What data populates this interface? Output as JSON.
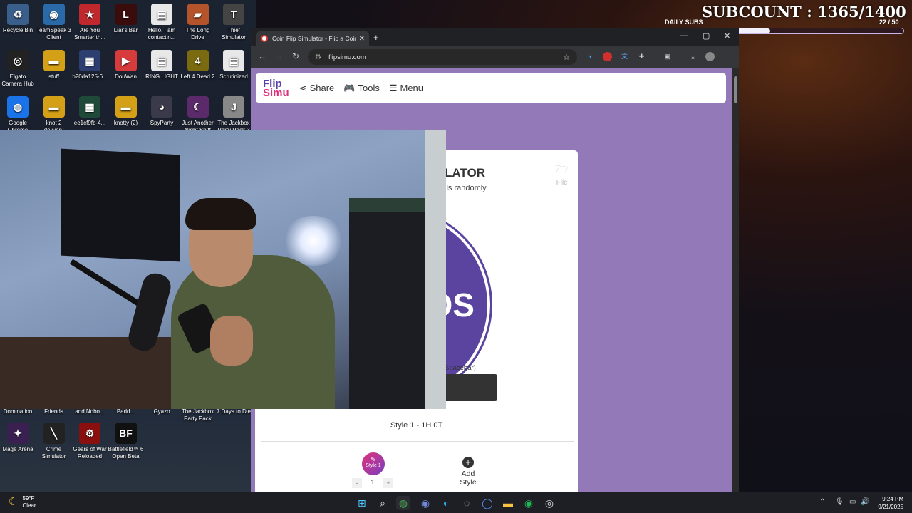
{
  "overlay": {
    "subcount": "SUBCOUNT : 1365/1400",
    "daily_label": "DAILY SUBS",
    "daily_count": "22  / 50",
    "daily_progress": 0.44
  },
  "desktop": {
    "icons": [
      {
        "label": "Recycle Bin",
        "icon": "recycle-bin-icon",
        "glyph": "♻",
        "color": "#3a5f8a"
      },
      {
        "label": "TeamSpeak 3 Client",
        "icon": "teamspeak-icon",
        "glyph": "◉",
        "color": "#2b6aa8"
      },
      {
        "label": "Are You Smarter th...",
        "icon": "game-icon",
        "glyph": "★",
        "color": "#c0282d"
      },
      {
        "label": "Liar's Bar",
        "icon": "liars-bar-icon",
        "glyph": "L",
        "color": "#3a0c0c"
      },
      {
        "label": "Hello, I am contactin...",
        "icon": "document-icon",
        "glyph": "▤",
        "color": "#e8e8e8"
      },
      {
        "label": "The Long Drive",
        "icon": "car-icon",
        "glyph": "▰",
        "color": "#b5532a"
      },
      {
        "label": "Thief Simulator",
        "icon": "thief-icon",
        "glyph": "T",
        "color": "#444"
      },
      {
        "label": "Elgato Camera Hub",
        "icon": "camera-icon",
        "glyph": "◎",
        "color": "#222"
      },
      {
        "label": "stuff",
        "icon": "folder-icon",
        "glyph": "▬",
        "color": "#d4a017"
      },
      {
        "label": "b20da125-6...",
        "icon": "image-icon",
        "glyph": "▦",
        "color": "#2d3e70"
      },
      {
        "label": "DouWan",
        "icon": "douwan-icon",
        "glyph": "▶",
        "color": "#d83b3b"
      },
      {
        "label": "RING LIGHT",
        "icon": "document-icon",
        "glyph": "▤",
        "color": "#e8e8e8"
      },
      {
        "label": "Left 4 Dead 2",
        "icon": "l4d2-icon",
        "glyph": "4",
        "color": "#7a6a10"
      },
      {
        "label": "Scrutinized",
        "icon": "document-icon",
        "glyph": "▤",
        "color": "#e8e8e8"
      },
      {
        "label": "Google Chrome",
        "icon": "chrome-icon",
        "glyph": "◍",
        "color": "#1a73e8"
      },
      {
        "label": "knot 2 delivery",
        "icon": "folder-icon",
        "glyph": "▬",
        "color": "#d4a017"
      },
      {
        "label": "ee1cf9fb-4...",
        "icon": "image-icon",
        "glyph": "▦",
        "color": "#1f4a3a"
      },
      {
        "label": "knotty (2)",
        "icon": "folder-icon",
        "glyph": "▬",
        "color": "#d4a017"
      },
      {
        "label": "SpyParty",
        "icon": "spyparty-icon",
        "glyph": "◕",
        "color": "#3a3a4a"
      },
      {
        "label": "Just Another Night Shift",
        "icon": "game-icon",
        "glyph": "☾",
        "color": "#5a2a6a"
      },
      {
        "label": "The Jackbox Party Pack 3",
        "icon": "jackbox-icon",
        "glyph": "J",
        "color": "#888"
      },
      {
        "label": "Domination",
        "icon": "game-icon",
        "glyph": "",
        "color": "transparent"
      },
      {
        "label": "Friends",
        "icon": "game-icon",
        "glyph": "",
        "color": "transparent"
      },
      {
        "label": "and Nobo...",
        "icon": "game-icon",
        "glyph": "",
        "color": "transparent"
      },
      {
        "label": "Padd...",
        "icon": "game-icon",
        "glyph": "",
        "color": "transparent"
      },
      {
        "label": "Gyazo",
        "icon": "gyazo-icon",
        "glyph": "G",
        "color": "#1e88e5"
      },
      {
        "label": "The Jackbox Party Pack",
        "icon": "jackbox-icon",
        "glyph": "J",
        "color": "#4a6ab0"
      },
      {
        "label": "7 Days to Die",
        "icon": "7dtd-icon",
        "glyph": "7",
        "color": "#6a1010"
      },
      {
        "label": "Mage Arena",
        "icon": "mage-arena-icon",
        "glyph": "✦",
        "color": "#3a2050"
      },
      {
        "label": "Crime Simulator",
        "icon": "crime-sim-icon",
        "glyph": "╲",
        "color": "#222"
      },
      {
        "label": "Gears of War Reloaded",
        "icon": "gears-icon",
        "glyph": "⚙",
        "color": "#8a1010"
      },
      {
        "label": "Battlefield™ 6 Open Beta",
        "icon": "battlefield-icon",
        "glyph": "BF",
        "color": "#111"
      }
    ]
  },
  "browser": {
    "tab_title": "Coin Flip Simulator - Flip a Coin",
    "url": "flipsimu.com",
    "new_tab": "+",
    "site": {
      "logo_line1": "Flip",
      "logo_line2": "Simu",
      "nav": {
        "share": "Share",
        "tools": "Tools",
        "menu": "Menu"
      },
      "title_partial": "LATOR",
      "subtitle_partial": "ils randomly",
      "file_label": "File",
      "coin_text": "OS",
      "hint_partial": "Spacebar)",
      "result": "Style 1 -   1H    0T",
      "style_badge": "Style 1",
      "stepper_value": "1",
      "add_style": "Add Style"
    }
  },
  "taskbar": {
    "weather_temp": "59°F",
    "weather_cond": "Clear",
    "time": "9:24 PM",
    "date": "9/21/2025"
  }
}
